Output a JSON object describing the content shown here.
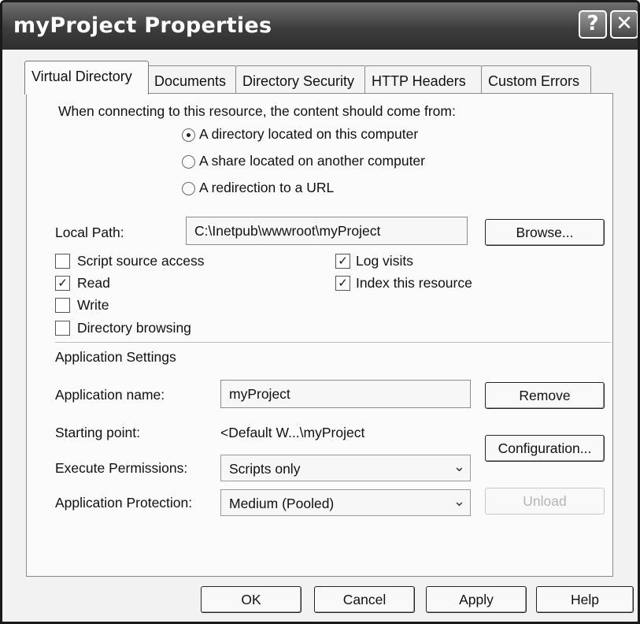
{
  "window": {
    "title": "myProject Properties",
    "help_glyph": "?",
    "close_glyph": "✕"
  },
  "tabs": [
    {
      "label": "Virtual Directory",
      "active": true
    },
    {
      "label": "Documents",
      "active": false
    },
    {
      "label": "Directory Security",
      "active": false
    },
    {
      "label": "HTTP Headers",
      "active": false
    },
    {
      "label": "Custom Errors",
      "active": false
    }
  ],
  "content_source": {
    "prompt": "When connecting to this resource, the content should come from:",
    "options": [
      {
        "label": "A directory located on this computer",
        "selected": true
      },
      {
        "label": "A share located on another computer",
        "selected": false
      },
      {
        "label": "A redirection to a URL",
        "selected": false
      }
    ]
  },
  "local_path": {
    "label": "Local Path:",
    "value": "C:\\Inetpub\\wwwroot\\myProject",
    "browse_label": "Browse..."
  },
  "permissions": [
    {
      "label": "Script source access",
      "checked": false
    },
    {
      "label": "Read",
      "checked": true
    },
    {
      "label": "Write",
      "checked": false
    },
    {
      "label": "Directory browsing",
      "checked": false
    },
    {
      "label": "Log visits",
      "checked": true
    },
    {
      "label": "Index this resource",
      "checked": true
    }
  ],
  "application_settings": {
    "heading": "Application Settings",
    "name_label": "Application name:",
    "name_value": "myProject",
    "remove_label": "Remove",
    "starting_point_label": "Starting point:",
    "starting_point_value": "<Default W...\\myProject",
    "configuration_label": "Configuration...",
    "execute_label": "Execute Permissions:",
    "execute_value": "Scripts only",
    "protection_label": "Application Protection:",
    "protection_value": "Medium (Pooled)",
    "unload_label": "Unload"
  },
  "footer": {
    "ok_label": "OK",
    "cancel_label": "Cancel",
    "apply_label": "Apply",
    "help_label": "Help"
  },
  "icons": {
    "check": "✓",
    "dropdown": "⌄"
  }
}
